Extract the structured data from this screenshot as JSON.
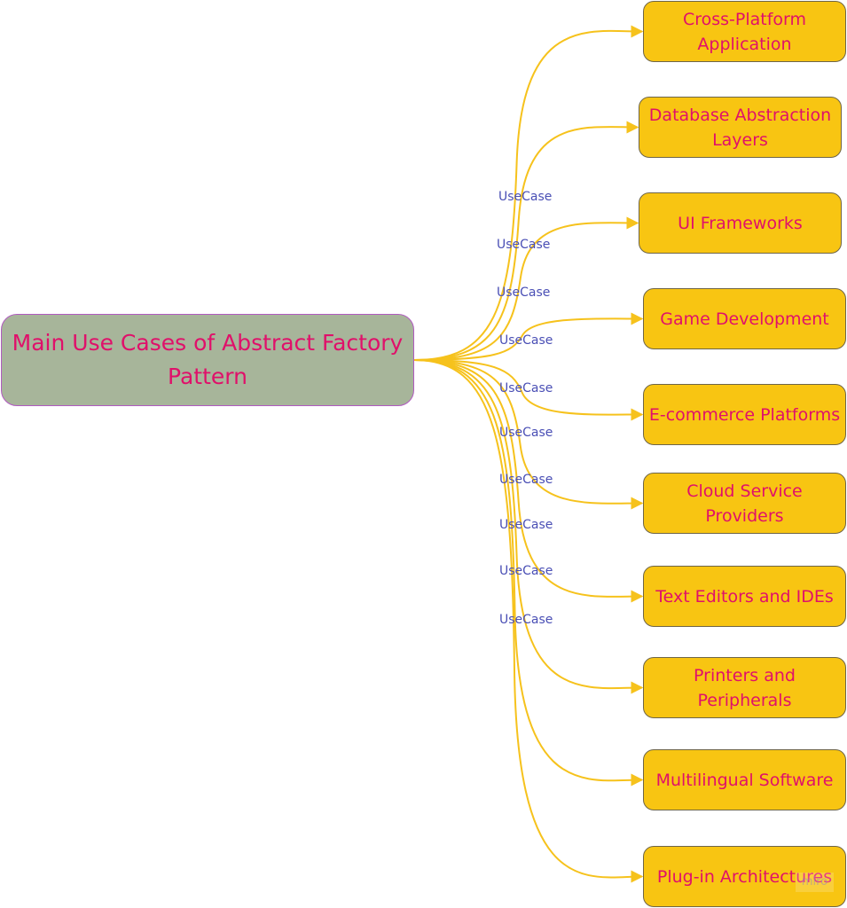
{
  "diagram": {
    "type": "mind-map",
    "root": {
      "label": "Main Use Cases of Abstract Factory Pattern"
    },
    "edge_label": "UseCase",
    "children": [
      {
        "label": "Cross-Platform Application"
      },
      {
        "label": "Database Abstraction Layers"
      },
      {
        "label": "UI Frameworks"
      },
      {
        "label": "Game Development"
      },
      {
        "label": "E-commerce Platforms"
      },
      {
        "label": "Cloud Service Providers"
      },
      {
        "label": "Text Editors and IDEs"
      },
      {
        "label": "Printers and Peripherals"
      },
      {
        "label": "Multilingual Software"
      },
      {
        "label": "Plug-in Architectures"
      }
    ],
    "edge_labels": [
      "UseCase",
      "UseCase",
      "UseCase",
      "UseCase",
      "UseCase",
      "UseCase",
      "UseCase",
      "UseCase",
      "UseCase",
      "UseCase"
    ],
    "colors": {
      "root_fill": "#a7b59a",
      "root_border": "#b05ac0",
      "node_fill": "#f8c512",
      "node_border": "#6e6548",
      "text": "#e0106a",
      "edge": "#f6c21c",
      "edge_label": "#4a4fb5"
    },
    "watermark": "miro"
  }
}
